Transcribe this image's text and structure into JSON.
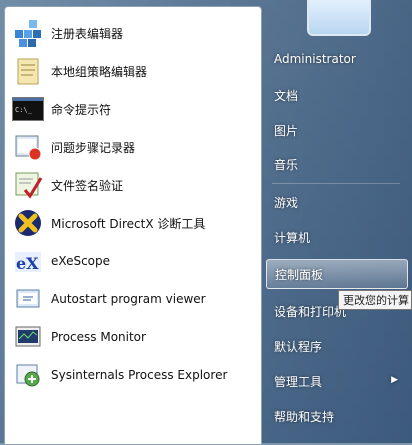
{
  "left_items": [
    {
      "label": "注册表编辑器",
      "icon": "registry-editor-icon"
    },
    {
      "label": "本地组策略编辑器",
      "icon": "group-policy-icon"
    },
    {
      "label": "命令提示符",
      "icon": "command-prompt-icon"
    },
    {
      "label": "问题步骤记录器",
      "icon": "steps-recorder-icon"
    },
    {
      "label": "文件签名验证",
      "icon": "signature-verify-icon"
    },
    {
      "label": "Microsoft DirectX 诊断工具",
      "icon": "directx-icon"
    },
    {
      "label": "eXeScope",
      "icon": "exescope-icon"
    },
    {
      "label": "Autostart program viewer",
      "icon": "autostart-icon"
    },
    {
      "label": "Process Monitor",
      "icon": "process-monitor-icon"
    },
    {
      "label": "Sysinternals Process Explorer",
      "icon": "process-explorer-icon"
    }
  ],
  "right_items": [
    {
      "label": "Administrator"
    },
    {
      "label": "文档"
    },
    {
      "label": "图片"
    },
    {
      "label": "音乐"
    },
    {
      "label": "游戏"
    },
    {
      "label": "计算机"
    },
    {
      "label": "控制面板"
    },
    {
      "label": "设备和打印机"
    },
    {
      "label": "默认程序"
    },
    {
      "label": "管理工具"
    },
    {
      "label": "帮助和支持"
    }
  ],
  "tooltip": "更改您的计算",
  "submenu_arrow": "▶"
}
